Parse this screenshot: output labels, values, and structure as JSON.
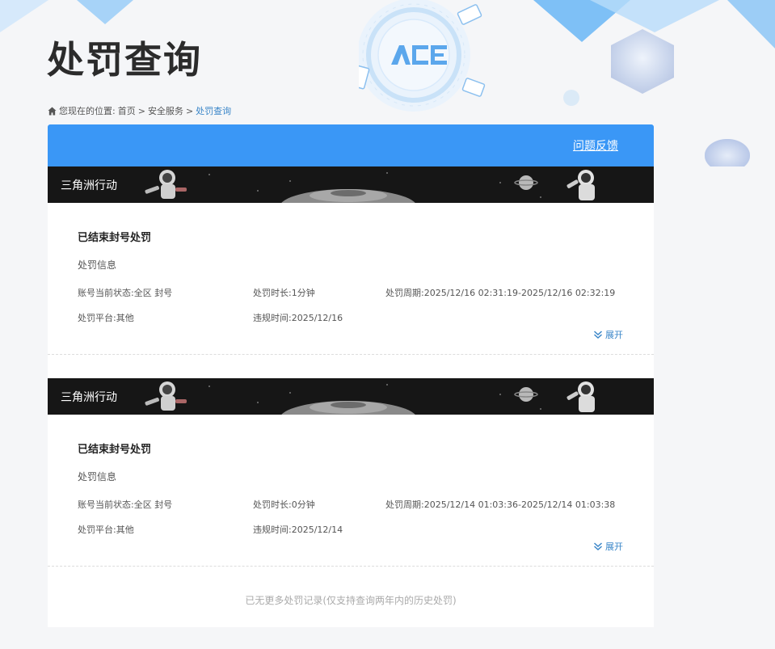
{
  "page": {
    "title": "处罚查询"
  },
  "breadcrumb": {
    "prefix": "您现在的位置:",
    "home": "首页",
    "sep1": ">",
    "security": "安全服务",
    "sep2": ">",
    "current": "处罚查询"
  },
  "header": {
    "feedback_label": "问题反馈"
  },
  "records": [
    {
      "game": "三角洲行动",
      "status": "已结束封号处罚",
      "info_label": "处罚信息",
      "account_state": "账号当前状态:全区 封号",
      "duration": "处罚时长:1分钟",
      "period": "处罚周期:2025/12/16 02:31:19-2025/12/16 02:32:19",
      "platform": "处罚平台:其他",
      "violation_time": "违规时间:2025/12/16",
      "expand_label": "展开"
    },
    {
      "game": "三角洲行动",
      "status": "已结束封号处罚",
      "info_label": "处罚信息",
      "account_state": "账号当前状态:全区 封号",
      "duration": "处罚时长:0分钟",
      "period": "处罚周期:2025/12/14 01:03:36-2025/12/14 01:03:38",
      "platform": "处罚平台:其他",
      "violation_time": "违规时间:2025/12/14",
      "expand_label": "展开"
    }
  ],
  "footer": {
    "note": "已无更多处罚记录(仅支持查询两年内的历史处罚)"
  },
  "colors": {
    "header_blue": "#3a97f6",
    "link_blue": "#3a86c8"
  }
}
